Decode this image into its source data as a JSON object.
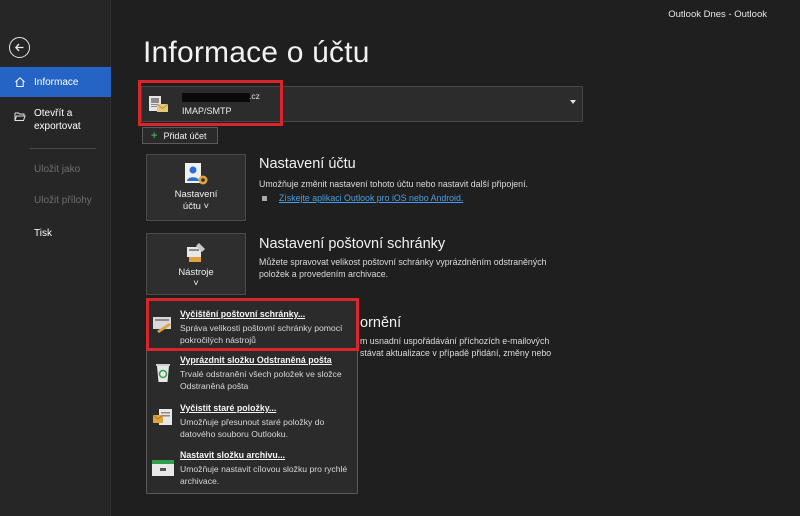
{
  "topbar": {
    "title": "Outlook Dnes  -  Outlook"
  },
  "sidebar": {
    "items": [
      {
        "label": "Informace"
      },
      {
        "label": "Otevřít a exportovat"
      },
      {
        "label": "Uložit jako"
      },
      {
        "label": "Uložit přílohy"
      },
      {
        "label": "Tisk"
      }
    ]
  },
  "page": {
    "title": "Informace o účtu"
  },
  "account": {
    "email_suffix": ".cz",
    "type": "IMAP/SMTP"
  },
  "add_account": {
    "label": "Přidat účet"
  },
  "sections": [
    {
      "tile_label_1": "Nastavení",
      "tile_label_2": "účtu ˅",
      "title": "Nastavení účtu",
      "description": "Umožňuje změnit nastavení tohoto účtu nebo nastavit další připojení.",
      "link": "Získejte aplikaci Outlook pro iOS nebo Android."
    },
    {
      "tile_label_1": "Nástroje",
      "tile_label_2": "˅",
      "title": "Nastavení poštovní schránky",
      "description": "Můžete spravovat velikost poštovní schránky vyprázdněním odstraněných položek a provedením archivace."
    },
    {
      "title_fragment": "ornění",
      "desc_line1": "m usnadní uspořádávání příchozích e-mailových",
      "desc_line2": "stávat aktualizace v případě přidání, změny nebo"
    }
  ],
  "tools_menu": [
    {
      "title": "Vyčištění poštovní schránky...",
      "description": "Správa velikosti poštovní schránky pomocí pokročilých nástrojů"
    },
    {
      "title": "Vyprázdnit složku Odstraněná pošta",
      "description": "Trvalé odstranění všech položek ve složce Odstraněná pošta"
    },
    {
      "title": "Vyčistit staré položky...",
      "description": "Umožňuje přesunout staré položky do datového souboru Outlooku."
    },
    {
      "title": "Nastavit složku archivu...",
      "description": "Umožňuje nastavit cílovou složku pro rychlé archivace."
    }
  ],
  "colors": {
    "accent": "#2563c4",
    "highlight": "#d8262c",
    "link": "#4a9ee8"
  }
}
